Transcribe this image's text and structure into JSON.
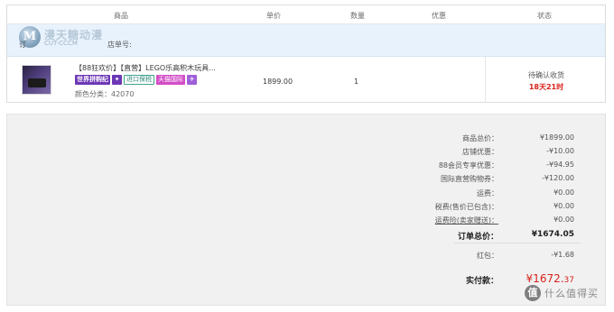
{
  "table_header": {
    "product": "商品",
    "unit_price": "单价",
    "quantity": "数量",
    "discount": "优惠",
    "status": "状态"
  },
  "store": {
    "logo_letter": "M",
    "logo_text": "漫天糖动漫",
    "logo_sub": "CUT-CCCM",
    "order_no_prefix": "订",
    "order_no_label": "店单号:"
  },
  "item": {
    "title": "【88狂欢价】【直营】LEGO乐高积木玩具...",
    "tags": {
      "world": "世界拼购纪",
      "shield": "✦",
      "import": "进口保税",
      "tmall": "天猫国际",
      "plane": "✈"
    },
    "attr": "颜色分类：42070",
    "price": "1899.00",
    "quantity": "1",
    "status": "待确认收货",
    "countdown": "18天21时"
  },
  "summary": {
    "rows": [
      {
        "label": "商品总价：",
        "value": "¥1899.00"
      },
      {
        "label": "店铺优惠：",
        "value": "-¥10.00"
      },
      {
        "label": "88会员专享优惠：",
        "value": "-¥94.95"
      },
      {
        "label": "国际直营购物券：",
        "value": "-¥120.00"
      },
      {
        "label": "运费：",
        "value": "¥0.00"
      },
      {
        "label": "税费(售价已包含)：",
        "value": "¥0.00"
      },
      {
        "label": "运费险(卖家赠送)：",
        "value": "¥0.00"
      }
    ],
    "total_label": "订单总价：",
    "total_value": "¥1674.05",
    "redpacket_label": "红包：",
    "redpacket_value": "-¥1.68",
    "pay_label": "实付款：",
    "pay_value_main": "¥1672.",
    "pay_value_cents": "37"
  },
  "watermark": {
    "icon": "值",
    "text": "什么值得买"
  },
  "colors": {
    "store_bar": "#e8f2fd",
    "accent_red": "#d8221b",
    "tag_purple": "#6c37b5",
    "summary_bg": "#f1f1f1"
  }
}
